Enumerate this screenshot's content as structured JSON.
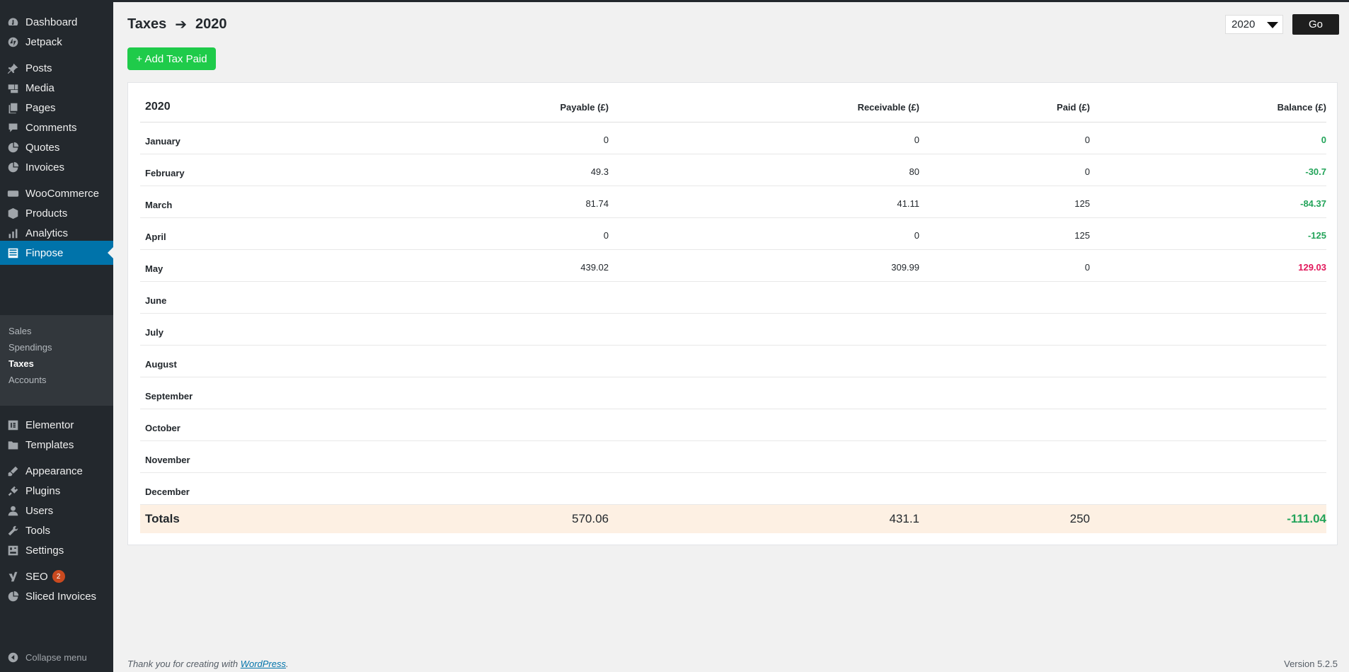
{
  "sidebar": {
    "items": [
      {
        "label": "Dashboard",
        "icon": "dashboard-icon"
      },
      {
        "label": "Jetpack",
        "icon": "jetpack-icon"
      },
      {
        "label": "Posts",
        "icon": "pin-icon"
      },
      {
        "label": "Media",
        "icon": "media-icon"
      },
      {
        "label": "Pages",
        "icon": "pages-icon"
      },
      {
        "label": "Comments",
        "icon": "comment-icon"
      },
      {
        "label": "Quotes",
        "icon": "pie-icon"
      },
      {
        "label": "Invoices",
        "icon": "pie-icon"
      },
      {
        "label": "WooCommerce",
        "icon": "woo-icon"
      },
      {
        "label": "Products",
        "icon": "box-icon"
      },
      {
        "label": "Analytics",
        "icon": "bar-chart-icon"
      },
      {
        "label": "Finpose",
        "icon": "table-icon"
      },
      {
        "label": "Elementor",
        "icon": "elementor-icon"
      },
      {
        "label": "Templates",
        "icon": "folder-icon"
      },
      {
        "label": "Appearance",
        "icon": "brush-icon"
      },
      {
        "label": "Plugins",
        "icon": "plug-icon"
      },
      {
        "label": "Users",
        "icon": "user-icon"
      },
      {
        "label": "Tools",
        "icon": "wrench-icon"
      },
      {
        "label": "Settings",
        "icon": "settings-icon"
      },
      {
        "label": "SEO",
        "icon": "yoast-icon",
        "badge": "2"
      },
      {
        "label": "Sliced Invoices",
        "icon": "pie-icon"
      }
    ],
    "submenu": [
      "Sales",
      "Spendings",
      "Taxes",
      "Accounts"
    ],
    "collapse_label": "Collapse menu"
  },
  "header": {
    "title": "Taxes",
    "year": "2020",
    "year_select": "2020",
    "go_label": "Go",
    "add_label": "+ Add Tax Paid"
  },
  "table": {
    "columns": [
      "2020",
      "Payable (£)",
      "Receivable (£)",
      "Paid (£)",
      "Balance (£)"
    ],
    "rows": [
      {
        "month": "January",
        "payable": "0",
        "receivable": "0",
        "paid": "0",
        "balance": "0"
      },
      {
        "month": "February",
        "payable": "49.3",
        "receivable": "80",
        "paid": "0",
        "balance": "-30.7"
      },
      {
        "month": "March",
        "payable": "81.74",
        "receivable": "41.11",
        "paid": "125",
        "balance": "-84.37"
      },
      {
        "month": "April",
        "payable": "0",
        "receivable": "0",
        "paid": "125",
        "balance": "-125"
      },
      {
        "month": "May",
        "payable": "439.02",
        "receivable": "309.99",
        "paid": "0",
        "balance": "129.03"
      },
      {
        "month": "June",
        "payable": "",
        "receivable": "",
        "paid": "",
        "balance": ""
      },
      {
        "month": "July",
        "payable": "",
        "receivable": "",
        "paid": "",
        "balance": ""
      },
      {
        "month": "August",
        "payable": "",
        "receivable": "",
        "paid": "",
        "balance": ""
      },
      {
        "month": "September",
        "payable": "",
        "receivable": "",
        "paid": "",
        "balance": ""
      },
      {
        "month": "October",
        "payable": "",
        "receivable": "",
        "paid": "",
        "balance": ""
      },
      {
        "month": "November",
        "payable": "",
        "receivable": "",
        "paid": "",
        "balance": ""
      },
      {
        "month": "December",
        "payable": "",
        "receivable": "",
        "paid": "",
        "balance": ""
      }
    ],
    "totals": {
      "label": "Totals",
      "payable": "570.06",
      "receivable": "431.1",
      "paid": "250",
      "balance": "-111.04"
    }
  },
  "colors": {
    "accent": "#0073aa",
    "positive": "#23a45a",
    "negative": "#e2185b",
    "add_button": "#1fcb4a"
  },
  "footer": {
    "thanks_prefix": "Thank you for creating with ",
    "thanks_link": "WordPress",
    "thanks_suffix": ".",
    "version": "Version 5.2.5"
  }
}
